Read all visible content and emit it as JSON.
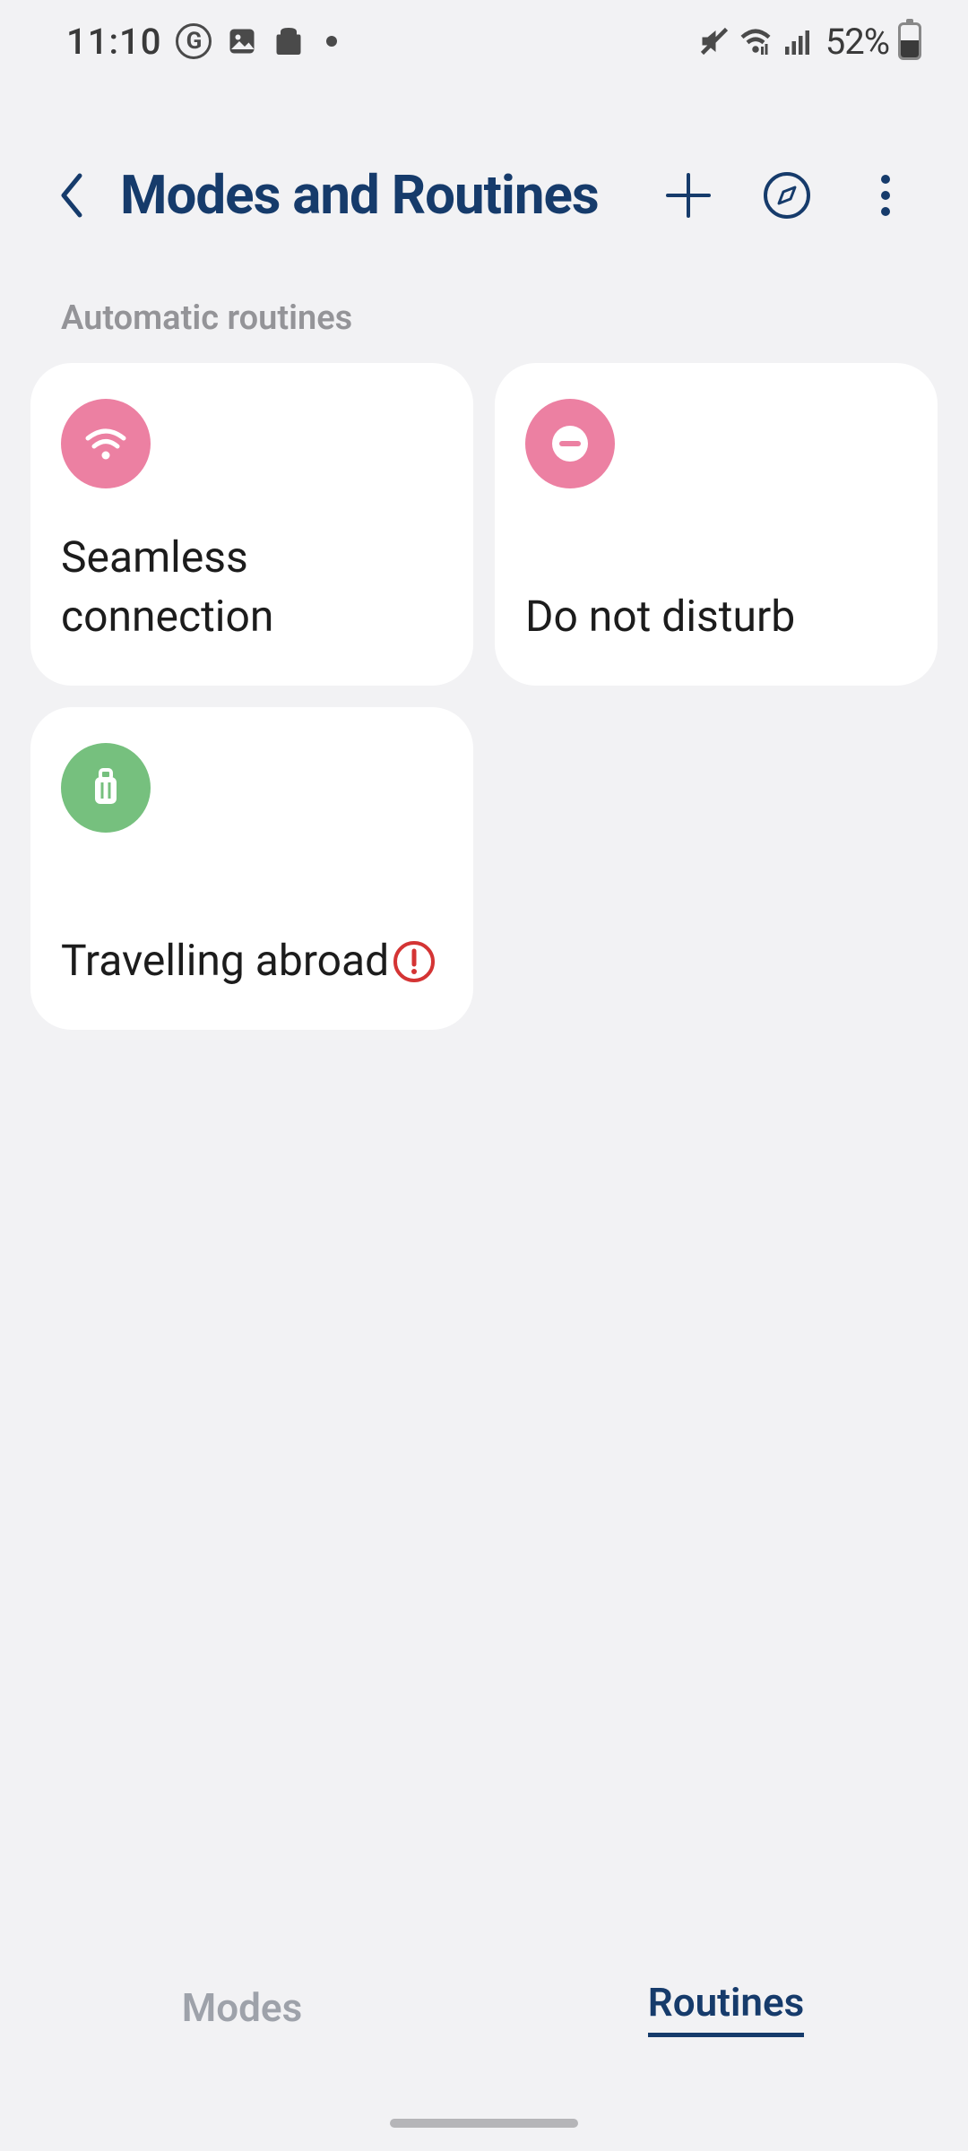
{
  "status": {
    "time": "11:10",
    "battery_text": "52%"
  },
  "header": {
    "title": "Modes and Routines"
  },
  "section": {
    "automatic_label": "Automatic routines"
  },
  "routines": [
    {
      "title": "Seamless connection",
      "icon": "wifi-icon",
      "color": "pink",
      "alert": false
    },
    {
      "title": "Do not disturb",
      "icon": "dnd-icon",
      "color": "pink",
      "alert": false
    },
    {
      "title": "Travelling abroad",
      "icon": "luggage-icon",
      "color": "green",
      "alert": true
    }
  ],
  "tabs": {
    "modes": "Modes",
    "routines": "Routines",
    "active": "routines"
  },
  "colors": {
    "accent": "#163b6b",
    "pink": "#ec80a2",
    "green": "#76c07e",
    "alert": "#d43434"
  }
}
